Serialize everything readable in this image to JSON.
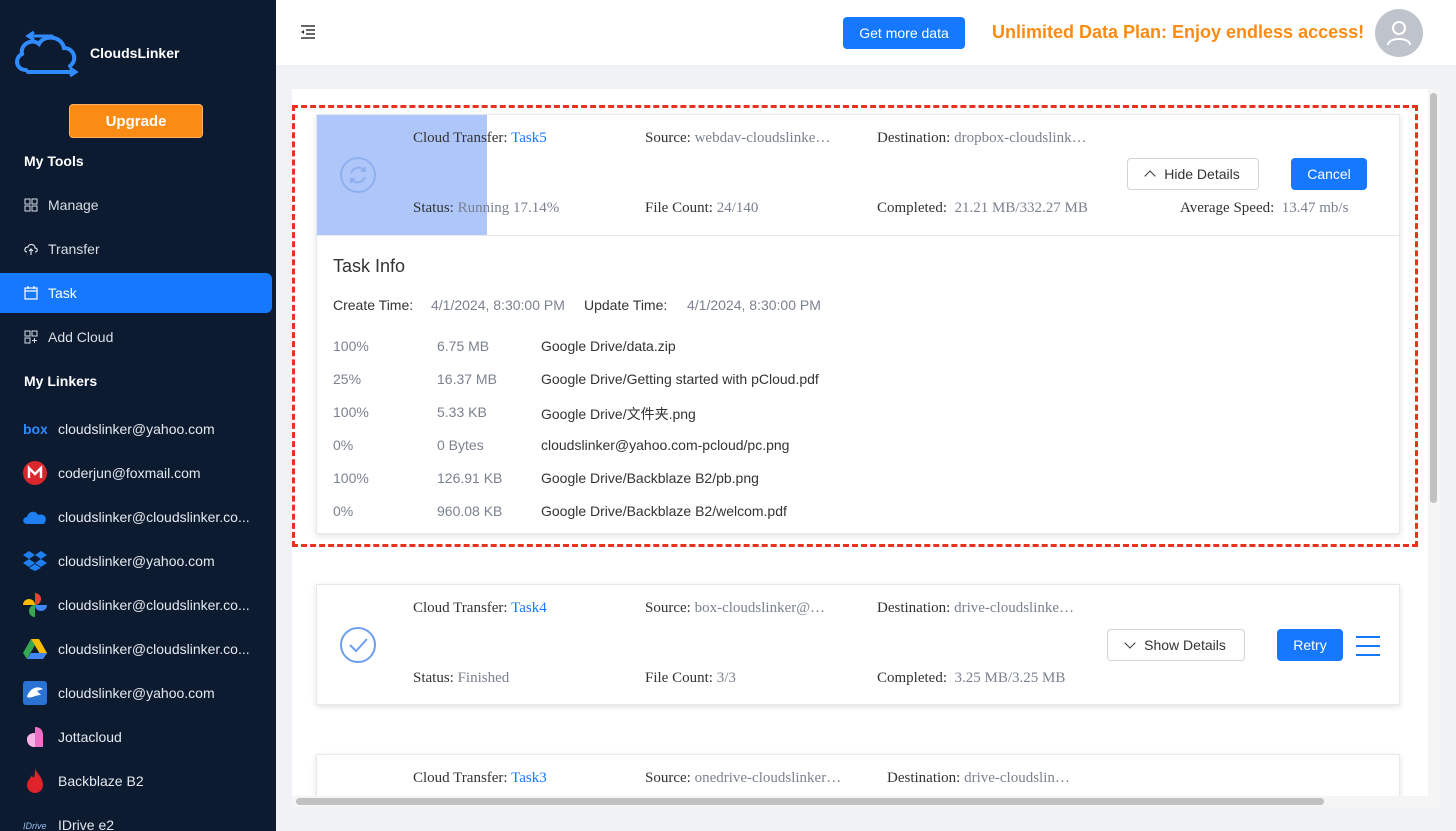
{
  "app": {
    "name": "CloudsLinker"
  },
  "sidebar": {
    "upgrade_label": "Upgrade",
    "tools_title": "My Tools",
    "tools": [
      {
        "label": "Manage",
        "icon": "grid-icon"
      },
      {
        "label": "Transfer",
        "icon": "cloud-upload-icon"
      },
      {
        "label": "Task",
        "icon": "calendar-icon",
        "active": true
      },
      {
        "label": "Add Cloud",
        "icon": "add-grid-icon"
      }
    ],
    "linkers_title": "My Linkers",
    "linkers": [
      {
        "label": "cloudslinker@yahoo.com",
        "icon": "box-icon"
      },
      {
        "label": "coderjun@foxmail.com",
        "icon": "mega-icon"
      },
      {
        "label": "cloudslinker@cloudslinker.co...",
        "icon": "onedrive-icon"
      },
      {
        "label": "cloudslinker@yahoo.com",
        "icon": "dropbox-icon"
      },
      {
        "label": "cloudslinker@cloudslinker.co...",
        "icon": "google-photos-icon"
      },
      {
        "label": "cloudslinker@cloudslinker.co...",
        "icon": "google-drive-icon"
      },
      {
        "label": "cloudslinker@yahoo.com",
        "icon": "pcloud-eagle-icon"
      },
      {
        "label": "Jottacloud",
        "icon": "jottacloud-icon"
      },
      {
        "label": "Backblaze B2",
        "icon": "backblaze-icon"
      },
      {
        "label": "IDrive e2",
        "icon": "idrive-icon"
      }
    ]
  },
  "header": {
    "get_more_label": "Get more data",
    "promo_text": "Unlimited Data Plan: Enjoy endless access!"
  },
  "tasks": [
    {
      "transfer_label": "Cloud Transfer:",
      "name": "Task5",
      "source_label": "Source:",
      "source": "webdav-cloudslinke…",
      "destination_label": "Destination:",
      "destination": "dropbox-cloudslink…",
      "status_label": "Status:",
      "status": "Running 17.14%",
      "file_count_label": "File Count:",
      "file_count": "24/140",
      "completed_label": "Completed:",
      "completed": "21.21 MB/332.27 MB",
      "speed_label": "Average Speed:",
      "speed": "13.47 mb/s",
      "details_button": "Hide Details",
      "action_button": "Cancel",
      "info": {
        "title": "Task Info",
        "create_label": "Create Time:",
        "create_time": "4/1/2024, 8:30:00 PM",
        "update_label": "Update Time:",
        "update_time": "4/1/2024, 8:30:00 PM",
        "files": [
          {
            "pct": "100%",
            "size": "6.75 MB",
            "path": "Google Drive/data.zip"
          },
          {
            "pct": "25%",
            "size": "16.37 MB",
            "path": "Google Drive/Getting started with pCloud.pdf"
          },
          {
            "pct": "100%",
            "size": "5.33 KB",
            "path": "Google Drive/文件夹.png"
          },
          {
            "pct": "0%",
            "size": "0 Bytes",
            "path": "cloudslinker@yahoo.com-pcloud/pc.png"
          },
          {
            "pct": "100%",
            "size": "126.91 KB",
            "path": "Google Drive/Backblaze B2/pb.png"
          },
          {
            "pct": "0%",
            "size": "960.08 KB",
            "path": "Google Drive/Backblaze B2/welcom.pdf"
          }
        ]
      }
    },
    {
      "transfer_label": "Cloud Transfer:",
      "name": "Task4",
      "source_label": "Source:",
      "source": "box-cloudslinker@…",
      "destination_label": "Destination:",
      "destination": "drive-cloudslinke…",
      "status_label": "Status:",
      "status": "Finished",
      "file_count_label": "File Count:",
      "file_count": "3/3",
      "completed_label": "Completed:",
      "completed": "3.25 MB/3.25 MB",
      "details_button": "Show Details",
      "action_button": "Retry"
    },
    {
      "transfer_label": "Cloud Transfer:",
      "name": "Task3",
      "source_label": "Source:",
      "source": "onedrive-cloudslinker…",
      "destination_label": "Destination:",
      "destination": "drive-cloudslin…"
    }
  ],
  "colors": {
    "accent": "#1677ff",
    "orange": "#fa8c16",
    "sidebar_bg": "#0c1b30",
    "highlight": "#e8321e"
  }
}
